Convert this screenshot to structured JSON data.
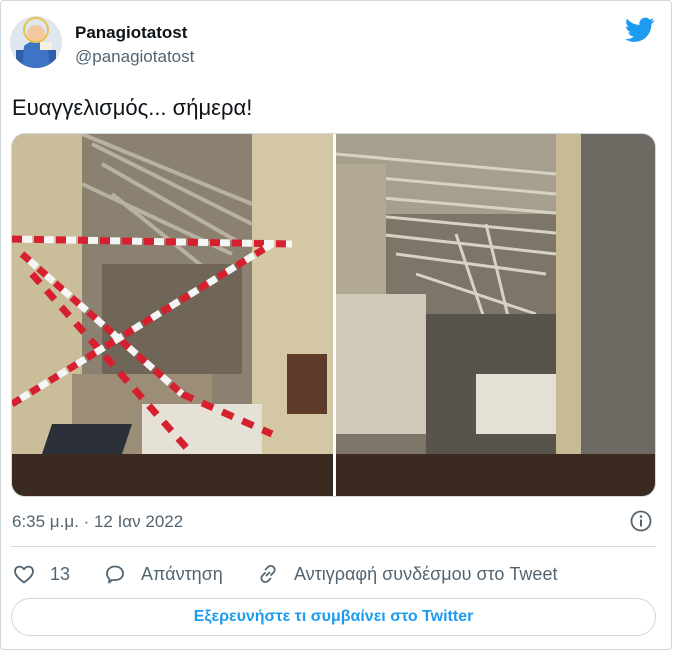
{
  "tweet": {
    "author_name": "Panagiotatost",
    "author_handle": "@panagiotatost",
    "text": "Ευαγγελισμός... σήμερα!",
    "timestamp": "6:35 μ.μ. · 12 Ιαν 2022"
  },
  "media": {
    "images": [
      {
        "description_icon": "photo-collapsed-ceiling-taped"
      },
      {
        "description_icon": "photo-collapsed-ceiling-corridor"
      }
    ]
  },
  "actions": {
    "like_count": "13",
    "reply_label": "Απάντηση",
    "copy_link_label": "Αντιγραφή συνδέσμου στο Tweet"
  },
  "footer": {
    "explore_label": "Εξερευνήστε τι συμβαίνει στο Twitter"
  },
  "icons": {
    "brand": "twitter-bird-icon",
    "info": "info-icon",
    "like": "heart-icon",
    "reply": "reply-bubble-icon",
    "link": "link-icon"
  },
  "colors": {
    "twitter_blue": "#1d9bf0",
    "secondary_text": "#536471",
    "border": "#cfd9de"
  }
}
